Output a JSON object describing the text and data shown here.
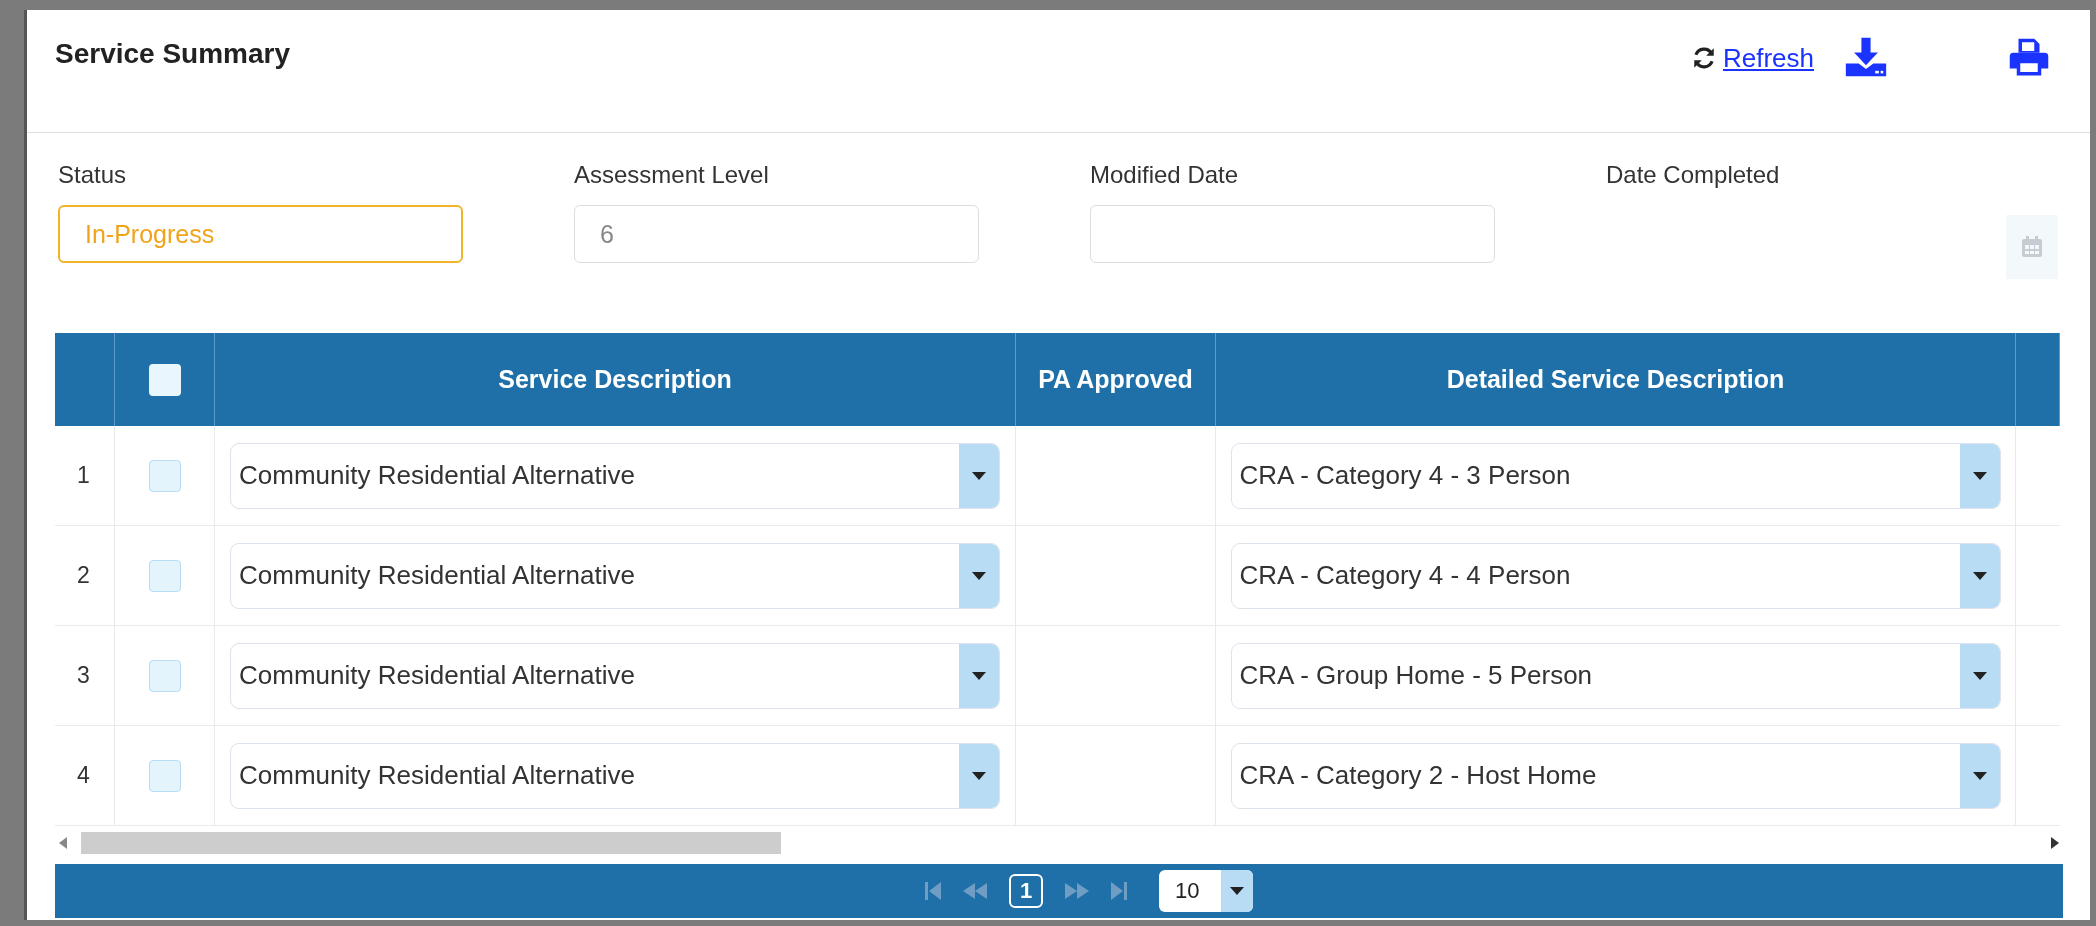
{
  "header": {
    "title": "Service Summary",
    "refresh_label": "Refresh",
    "actions": [
      {
        "kind": "download"
      },
      {
        "kind": "print"
      }
    ]
  },
  "fields": [
    {
      "kind": "status",
      "label": "Status",
      "value": "In-Progress"
    },
    {
      "kind": "readonly",
      "label": "Assessment Level",
      "value": "6"
    },
    {
      "kind": "text",
      "label": "Modified Date"
    },
    {
      "kind": "date",
      "label": "Date Completed"
    }
  ],
  "table": {
    "header_checkbox": {
      "checked": false
    },
    "columns": [
      "Service Description",
      "PA Approved",
      "Detailed Service Description"
    ],
    "rows": [
      {
        "number": "1",
        "checked": false,
        "service_description": "Community Residential Alternative",
        "detailed_service_description": "CRA - Category 4 - 3 Person"
      },
      {
        "number": "2",
        "checked": false,
        "service_description": "Community Residential Alternative",
        "detailed_service_description": "CRA - Category 4 - 4 Person"
      },
      {
        "number": "3",
        "checked": false,
        "service_description": "Community Residential Alternative",
        "detailed_service_description": "CRA - Group Home - 5 Person"
      },
      {
        "number": "4",
        "checked": false,
        "service_description": "Community Residential Alternative",
        "detailed_service_description": "CRA - Category 2 - Host Home"
      }
    ]
  },
  "pager": {
    "navigation_disabled": true,
    "pages": [
      {
        "label": "1",
        "selected": true
      }
    ],
    "page_size": "10"
  }
}
